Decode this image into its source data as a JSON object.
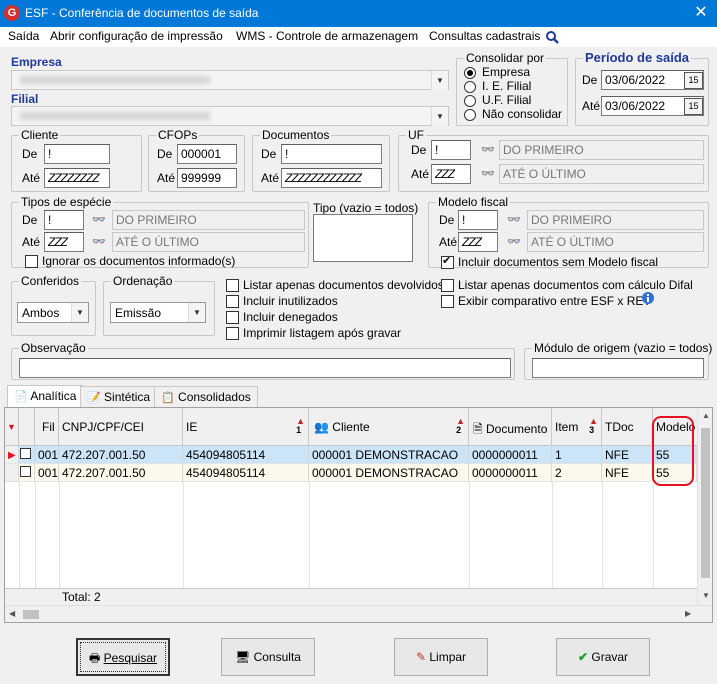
{
  "window": {
    "title": "ESF - Conferência de documentos de saída",
    "app_icon": "G",
    "close": "✕"
  },
  "menu": [
    "Saída",
    "Abrir configuração de impressão",
    "WMS - Controle de armazenagem",
    "Consultas cadastrais"
  ],
  "empresa": {
    "label": "Empresa"
  },
  "filial": {
    "label": "Filial"
  },
  "consolidar": {
    "title": "Consolidar por",
    "options": [
      "Empresa",
      "I. E. Filial",
      "U.F. Filial",
      "Não consolidar"
    ],
    "selected": "Empresa"
  },
  "periodo": {
    "title": "Período de saída",
    "de_label": "De",
    "de": "03/06/2022",
    "ate_label": "Até",
    "ate": "03/06/2022",
    "cal": "15"
  },
  "cliente": {
    "title": "Cliente",
    "de_label": "De",
    "de": "!",
    "ate_label": "Até",
    "ate": "ZZZZZZZZ"
  },
  "cfops": {
    "title": "CFOPs",
    "de_label": "De",
    "de": "000001",
    "ate_label": "Até",
    "ate": "999999"
  },
  "documentos": {
    "title": "Documentos",
    "de_label": "De",
    "de": "!",
    "ate_label": "Até",
    "ate": "ZZZZZZZZZZZZ"
  },
  "uf": {
    "title": "UF",
    "de_label": "De",
    "de": "!",
    "de_desc": "DO PRIMEIRO",
    "ate_label": "Até",
    "ate": "ZZZ",
    "ate_desc": "ATÉ O ÚLTIMO"
  },
  "especie": {
    "title": "Tipos de espécie",
    "de_label": "De",
    "de": "!",
    "de_desc": "DO PRIMEIRO",
    "ate_label": "Até",
    "ate": "ZZZ",
    "ate_desc": "ATÉ O ÚLTIMO",
    "ignorar": "Ignorar os documentos informado(s)"
  },
  "tipo": {
    "title": "Tipo (vazio = todos)"
  },
  "modelo": {
    "title": "Modelo fiscal",
    "de_label": "De",
    "de": "!",
    "de_desc": "DO PRIMEIRO",
    "ate_label": "Até",
    "ate": "ZZZ",
    "ate_desc": "ATÉ O ÚLTIMO",
    "incluir": "Incluir documentos sem Modelo fiscal"
  },
  "conferidos": {
    "title": "Conferidos",
    "value": "Ambos"
  },
  "ordenacao": {
    "title": "Ordenação",
    "value": "Emissão"
  },
  "options_mid": [
    "Listar apenas documentos devolvidos",
    "Incluir inutilizados",
    "Incluir denegados",
    "Imprimir listagem após gravar"
  ],
  "options_right": [
    "Listar apenas documentos com cálculo Difal",
    "Exibir comparativo entre ESF x RET"
  ],
  "observacao": {
    "title": "Observação"
  },
  "modulo": {
    "title": "Módulo de origem (vazio = todos)"
  },
  "tabs": [
    "Analítica",
    "Sintética",
    "Consolidados"
  ],
  "grid": {
    "headers": {
      "fil": "Fil",
      "cnpj": "CNPJ/CPF/CEI",
      "ie": "IE",
      "ie_sort": "1",
      "cliente": "Cliente",
      "cliente_sort": "2",
      "documento": "Documento",
      "item": "Item",
      "item_sort": "3",
      "tdoc": "TDoc",
      "modelo": "Modelo"
    },
    "rows": [
      {
        "fil": "001",
        "cnpj": "472.207.001.50",
        "ie": "454094805114",
        "cliente": "000001 DEMONSTRACAO",
        "documento": "0000000011",
        "item": "1",
        "tdoc": "NFE",
        "modelo": "55"
      },
      {
        "fil": "001",
        "cnpj": "472.207.001.50",
        "ie": "454094805114",
        "cliente": "000001 DEMONSTRACAO",
        "documento": "0000000011",
        "item": "2",
        "tdoc": "NFE",
        "modelo": "55"
      }
    ],
    "total": "Total: 2"
  },
  "buttons": {
    "pesquisar": "Pesquisar",
    "consulta": "Consulta",
    "limpar": "Limpar",
    "gravar": "Gravar"
  },
  "colors": {
    "titlebar": "#0078d7",
    "selected_row": "#cce4f7",
    "highlight": "#e81123",
    "label_blue": "#1f3a9b"
  }
}
